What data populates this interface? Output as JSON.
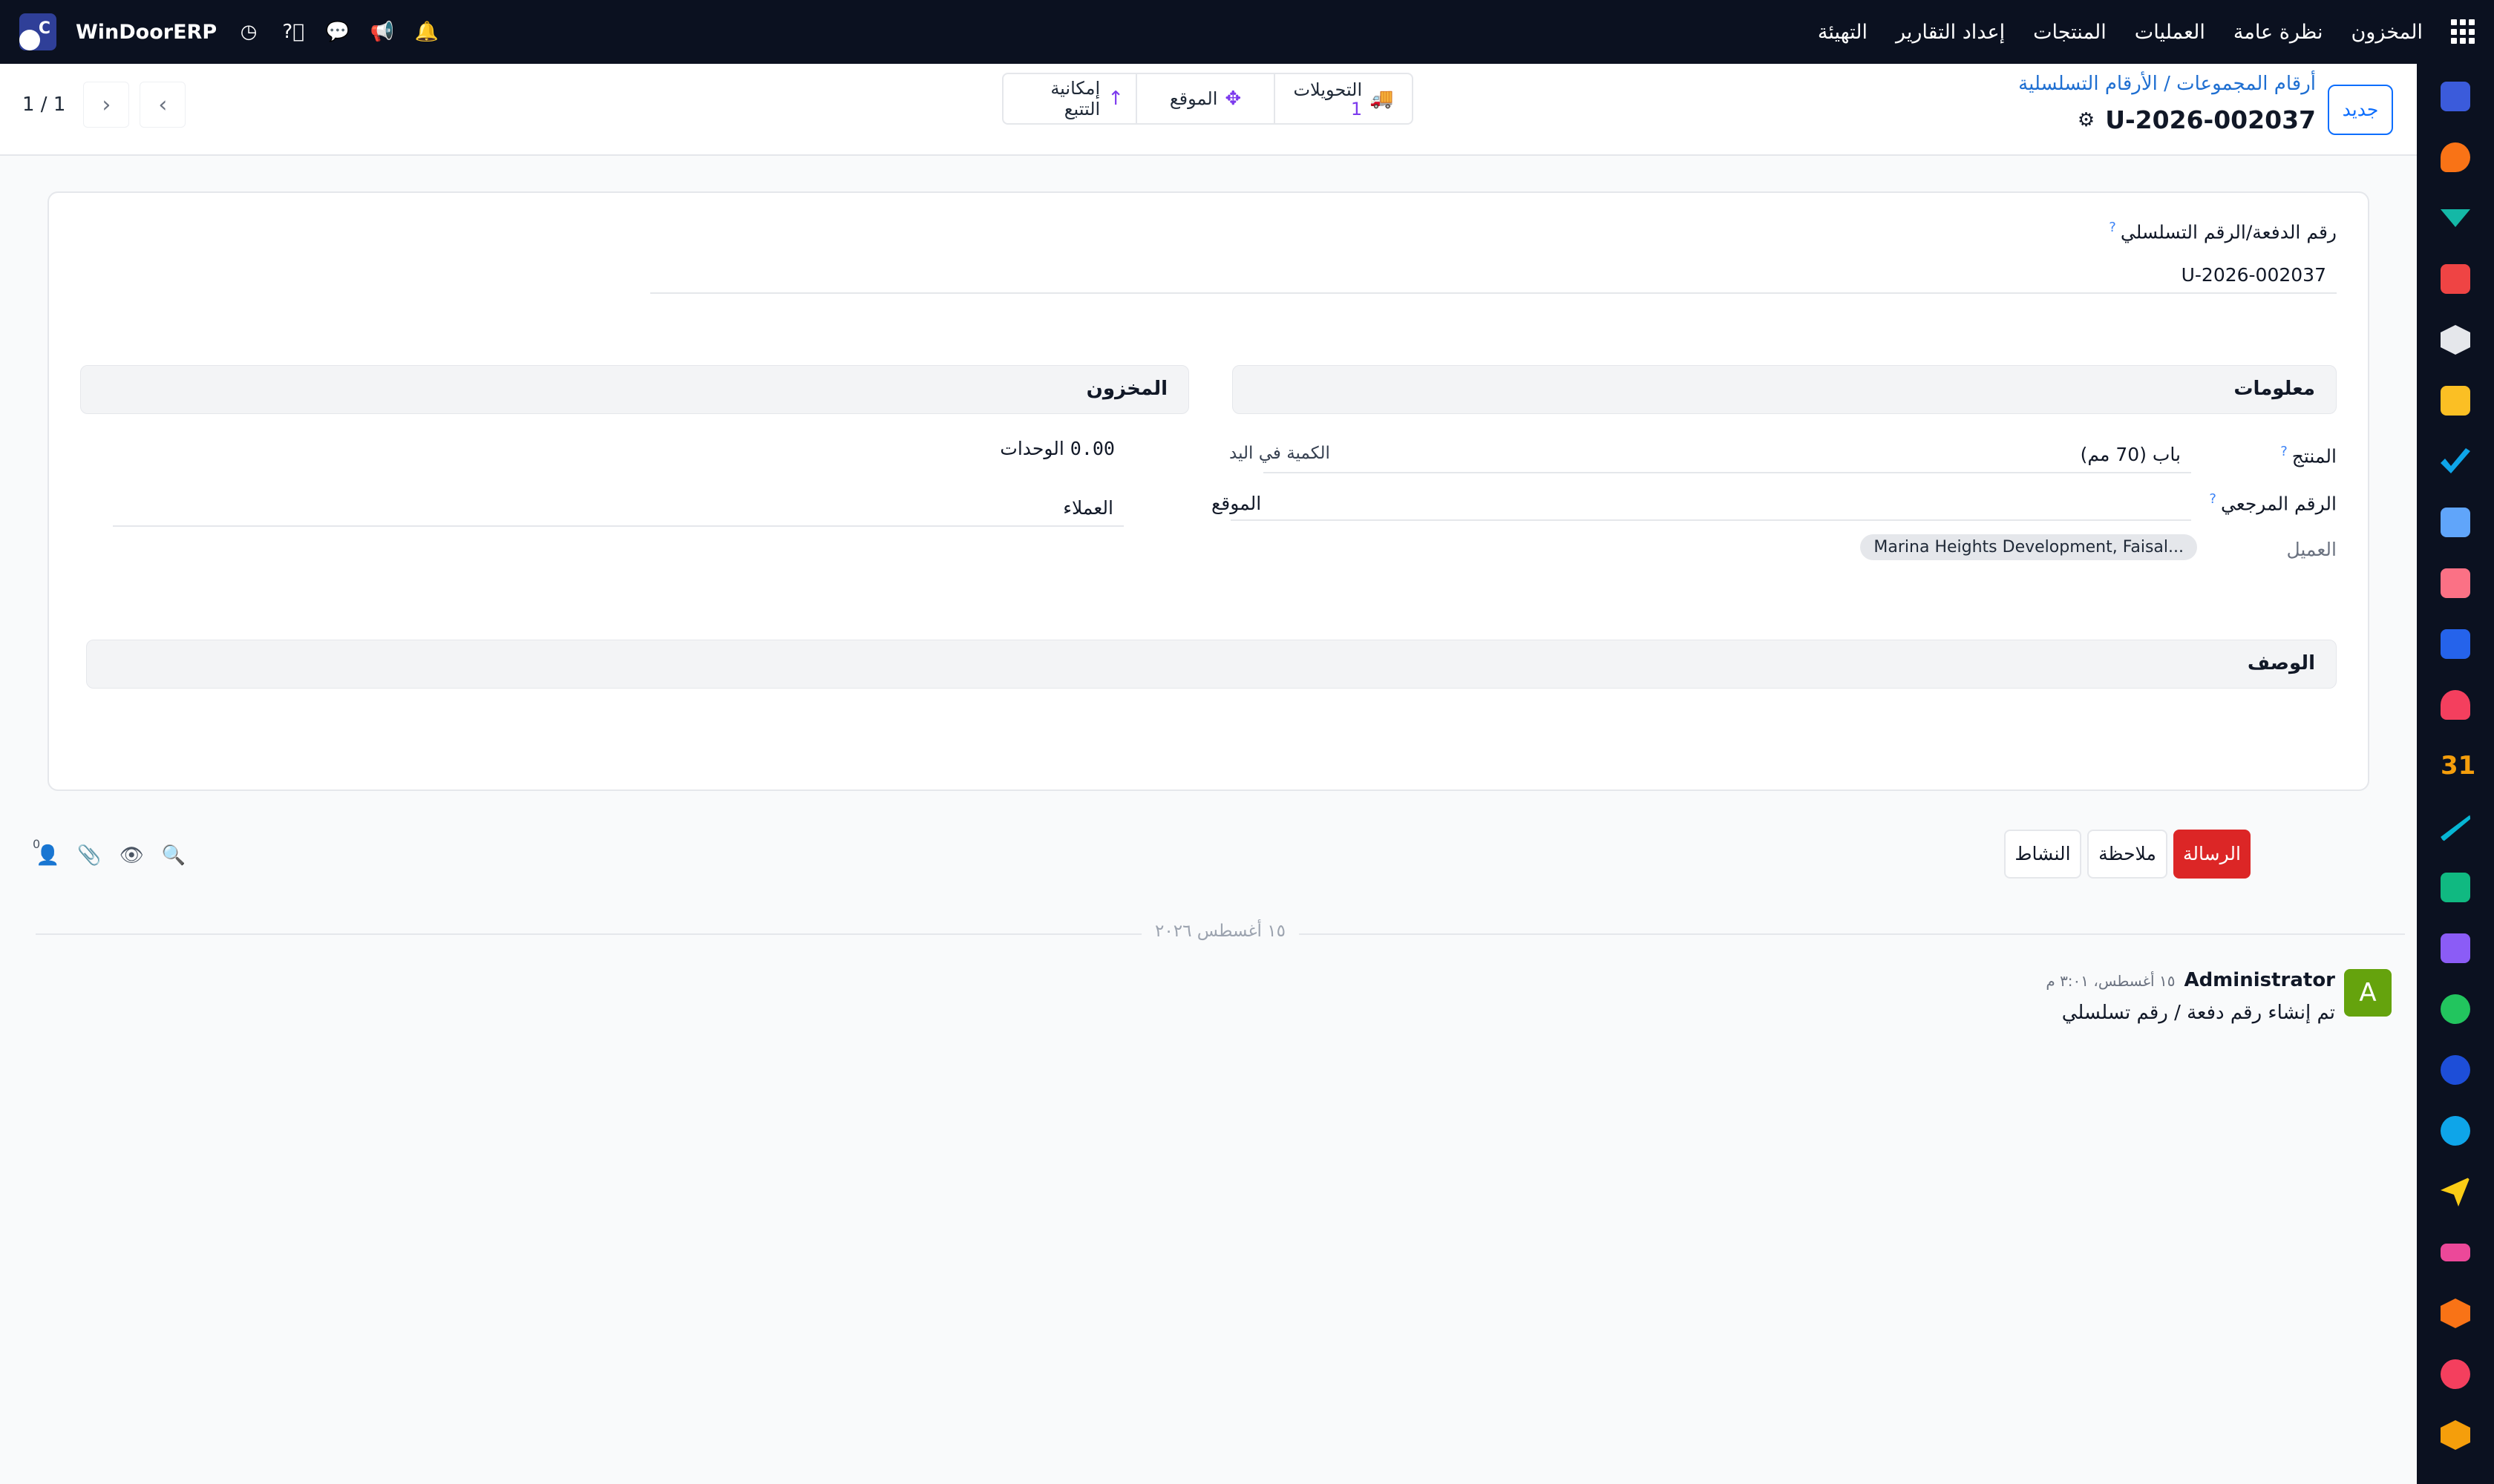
{
  "navbar": {
    "menu": [
      "المخزون",
      "نظرة عامة",
      "العمليات",
      "المنتجات",
      "إعداد التقارير",
      "التهيئة"
    ],
    "company_name": "WinDoorERP",
    "logo_letter": "C"
  },
  "control_panel": {
    "new_button": "جديد",
    "breadcrumb": "أرقام المجموعات / الأرقام التسلسلية",
    "record_title": "U-2026-002037",
    "smart_buttons": {
      "transfers_label": "التحويلات",
      "transfers_count": "1",
      "location_label": "الموقع",
      "traceability_label": "إمكانية التتبع"
    },
    "pager": "1 / 1"
  },
  "form": {
    "lot_label": "رقم الدفعة/الرقم التسلسلي",
    "lot_value": "U-2026-002037",
    "info_section": "معلومات",
    "inventory_section": "المخزون",
    "product_label": "المنتج",
    "product_value": "باب (70 مم)",
    "ref_label": "الرقم المرجعي",
    "ref_value": "",
    "customer_label": "العميل",
    "customer_value": "Marina Heights Development, Faisal...",
    "qty_label": "الكمية في اليد",
    "qty_number": "0.00",
    "qty_unit": "الوحدات",
    "location_label": "الموقع",
    "location_value": "العملاء",
    "description_section": "الوصف"
  },
  "chatter": {
    "send_message": "الرسالة",
    "log_note": "ملاحظة",
    "activity": "النشاط",
    "followers_count": "0",
    "date_separator": "١٥ أغسطس ٢٠٢٦",
    "message": {
      "avatar_letter": "A",
      "author": "Administrator",
      "date": "١٥ أغسطس، ٣:٠١ م",
      "body": "تم إنشاء رقم دفعة / رقم تسلسلي"
    }
  },
  "colors": {
    "navbar_bg": "#0b1120",
    "primary_blue": "#0d6efd",
    "accent_purple": "#7c3aed",
    "send_red": "#dc2626",
    "avatar_green": "#65a30d"
  }
}
